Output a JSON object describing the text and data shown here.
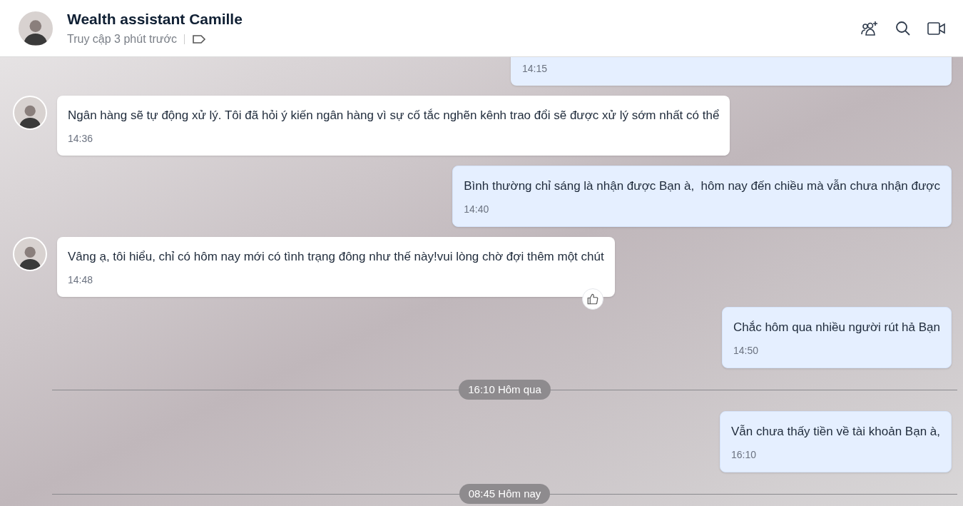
{
  "header": {
    "name": "Wealth assistant Camille",
    "status": "Truy cập 3 phút trước"
  },
  "messages": [
    {
      "kind": "partial",
      "time": "14:15"
    },
    {
      "kind": "incoming",
      "text": "Ngân hàng sẽ tự động xử lý. Tôi đã hỏi ý kiến ngân hàng vì sự cố tắc nghẽn kênh trao đổi sẽ được xử lý sớm nhất có thể",
      "time": "14:36",
      "liked": false
    },
    {
      "kind": "outgoing",
      "text": "Bình thường chỉ sáng là nhận được Bạn à,  hôm nay đến chiều mà vẫn chưa nhận được",
      "time": "14:40"
    },
    {
      "kind": "incoming",
      "text": "Vâng ạ, tôi hiểu, chỉ có hôm nay mới có tình trạng đông như thế này!vui lòng chờ đợi thêm một chút",
      "time": "14:48",
      "liked": true
    },
    {
      "kind": "outgoing",
      "text": "Chắc hôm qua nhiều người rút hả Bạn",
      "time": "14:50"
    },
    {
      "kind": "divider",
      "text": "16:10 Hôm qua"
    },
    {
      "kind": "outgoing",
      "text": "Vẫn chưa thấy tiền về tài khoản Bạn à,",
      "time": "16:10"
    },
    {
      "kind": "divider",
      "text": "08:45 Hôm nay"
    }
  ]
}
